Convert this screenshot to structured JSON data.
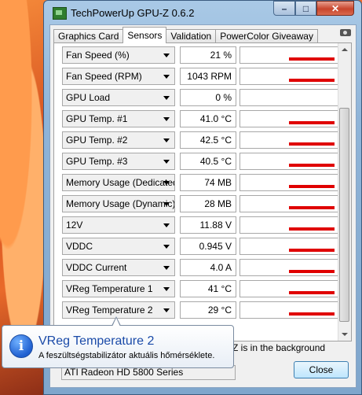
{
  "window": {
    "title": "TechPowerUp GPU-Z 0.6.2",
    "controls": {
      "minimize": "–",
      "maximize": "□",
      "close": "✕"
    }
  },
  "tabs": [
    {
      "label": "Graphics Card",
      "active": false
    },
    {
      "label": "Sensors",
      "active": true
    },
    {
      "label": "Validation",
      "active": false
    },
    {
      "label": "PowerColor Giveaway",
      "active": false
    }
  ],
  "sensors": [
    {
      "name": "Fan Speed (%)",
      "value": "21 %",
      "level": 0.93
    },
    {
      "name": "Fan Speed (RPM)",
      "value": "1043 RPM",
      "level": 0.93
    },
    {
      "name": "GPU Load",
      "value": "0 %",
      "level": 0.0
    },
    {
      "name": "GPU Temp. #1",
      "value": "41.0 °C",
      "level": 0.93
    },
    {
      "name": "GPU Temp. #2",
      "value": "42.5 °C",
      "level": 0.93
    },
    {
      "name": "GPU Temp. #3",
      "value": "40.5 °C",
      "level": 0.93
    },
    {
      "name": "Memory Usage (Dedicated)",
      "value": "74 MB",
      "level": 0.93
    },
    {
      "name": "Memory Usage (Dynamic)",
      "value": "28 MB",
      "level": 0.93
    },
    {
      "name": "12V",
      "value": "11.88 V",
      "level": 0.93
    },
    {
      "name": "VDDC",
      "value": "0.945 V",
      "level": 0.93
    },
    {
      "name": "VDDC Current",
      "value": "4.0 A",
      "level": 0.93
    },
    {
      "name": "VReg Temperature 1",
      "value": "41 °C",
      "level": 0.93
    },
    {
      "name": "VReg Temperature 2",
      "value": "29 °C",
      "level": 0.93
    }
  ],
  "footer": {
    "background_text": "Z is in the background",
    "gpu_select": "ATI Radeon HD 5800 Series",
    "close_label": "Close"
  },
  "tooltip": {
    "title": "VReg Temperature 2",
    "body": "A feszültségstabilizátor aktuális hőmérséklete.",
    "icon": "i"
  },
  "colors": {
    "graph_bar": "#e00000",
    "accent": "#1a4aa8"
  }
}
